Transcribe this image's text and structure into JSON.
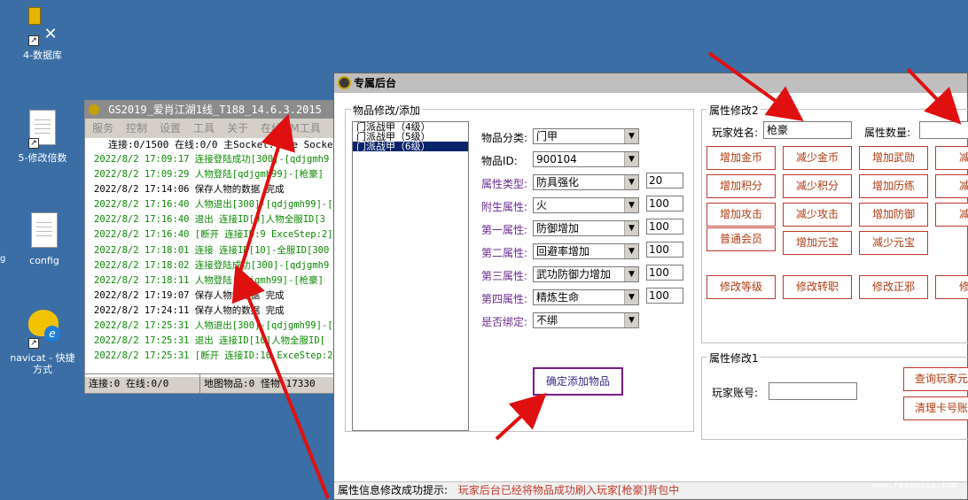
{
  "desktop": {
    "icons": [
      {
        "label": "4-数据库"
      },
      {
        "label": "5-修改倍数"
      },
      {
        "label": "config"
      },
      {
        "label": "navicat - 快捷方式"
      }
    ],
    "left_edge_label": "g"
  },
  "gs_window": {
    "title": "GS2019_爱肖江湖1线_T188_14.6.3.2015",
    "menu": [
      "服务",
      "控制",
      "设置",
      "工具",
      "关于",
      "在线GM工具"
    ],
    "status_line": "连接:0/1500  在线:0/0  主Socket:true  Socket",
    "log": [
      {
        "text": "2022/8/2  17:09:17 连接登陆成功[300]-[qdjgmh9",
        "type": "ok"
      },
      {
        "text": "2022/8/2  17:09:29 人物登陆[qdjgmh99]-[枪豪]",
        "type": "ok"
      },
      {
        "text": "2022/8/2  17:14:06 保存人物的数据 完成",
        "type": "blk"
      },
      {
        "text": "2022/8/2  17:16:40 人物退出[300]-[qdjgmh99]-[",
        "type": "ok"
      },
      {
        "text": "2022/8/2  17:16:40 退出 连接ID[9]人物全服ID[3",
        "type": "ok"
      },
      {
        "text": "2022/8/2  17:16:40 [断开 连接ID:9 ExceStep:2]",
        "type": "ok"
      },
      {
        "text": "2022/8/2  17:18:01 连接 连接ID[10]-全服ID[300",
        "type": "ok"
      },
      {
        "text": "2022/8/2  17:18:02 连接登陆成功[300]-[qdjgmh9",
        "type": "ok"
      },
      {
        "text": "2022/8/2  17:18:11 人物登陆[qdjgmh99]-[枪豪]",
        "type": "ok"
      },
      {
        "text": "2022/8/2  17:19:07 保存人物的数据 完成",
        "type": "blk"
      },
      {
        "text": "2022/8/2  17:24:11 保存人物的数据 完成",
        "type": "blk"
      },
      {
        "text": "2022/8/2  17:25:31 人物退出[300]-[qdjgmh99]-[",
        "type": "ok"
      },
      {
        "text": "2022/8/2  17:25:31 退出 连接ID[10]人物全服ID[",
        "type": "ok"
      },
      {
        "text": "2022/8/2  17:25:31 [断开 连接ID:10 ExceStep:2",
        "type": "ok"
      }
    ],
    "footer": [
      "连接:0 在线:0/0",
      "地图物品:0 怪物:17330"
    ]
  },
  "main_window": {
    "title": "专属后台",
    "item_group": {
      "legend": "物品修改/添加",
      "list_items": [
        "门派战甲（4级）",
        "门派战甲（5级）",
        "门派战甲（6级）"
      ],
      "selected_index": 2,
      "fields": [
        {
          "label": "物品分类:",
          "value": "门甲",
          "num": ""
        },
        {
          "label": "物品ID:",
          "value": "900104",
          "num": ""
        },
        {
          "label": "属性类型:",
          "value": "防具强化",
          "num": "20"
        },
        {
          "label": "附生属性:",
          "value": "火",
          "num": "100"
        },
        {
          "label": "第一属性:",
          "value": "防御增加",
          "num": "100"
        },
        {
          "label": "第二属性:",
          "value": "回避率增加",
          "num": "100"
        },
        {
          "label": "第三属性:",
          "value": "武功防御力增加",
          "num": "100"
        },
        {
          "label": "第四属性:",
          "value": "精炼生命",
          "num": "100"
        },
        {
          "label": "是否绑定:",
          "value": "不绑",
          "num": ""
        }
      ],
      "confirm_button": "确定添加物品"
    },
    "attr_group2": {
      "legend": "属性修改2",
      "player_name_label": "玩家姓名:",
      "player_name_value": "枪豪",
      "attr_count_label": "属性数量:",
      "attr_count_value": "",
      "buttons_row1": [
        "增加金币",
        "减少金币",
        "增加武勋",
        "减少"
      ],
      "buttons_row2": [
        "增加积分",
        "减少积分",
        "增加历练",
        "减少"
      ],
      "buttons_row3": [
        "增加攻击",
        "减少攻击",
        "增加防御",
        "减少"
      ],
      "buttons_row4": [
        "普通会员",
        "增加元宝",
        "减少元宝"
      ],
      "buttons_row5": [
        "修改等级",
        "修改转职",
        "修改正邪",
        "修改"
      ]
    },
    "attr_group1": {
      "legend": "属性修改1",
      "account_label": "玩家账号:",
      "account_value": "",
      "query_button": "查询玩家元",
      "clear_button": "清理卡号账"
    },
    "status_bar": {
      "label": "属性信息修改成功提示:",
      "message": "玩家后台已经将物品成功刷入玩家[枪豪]背包中"
    }
  },
  "watermark": {
    "line1": "热血侠网游单机论坛",
    "line2": "www.rexuexia.com"
  },
  "colors": {
    "desktop": "#3a6ea5",
    "log_green": "#0a8a00",
    "button_red": "#c0392b",
    "annotation_arrow": "#e01010"
  }
}
